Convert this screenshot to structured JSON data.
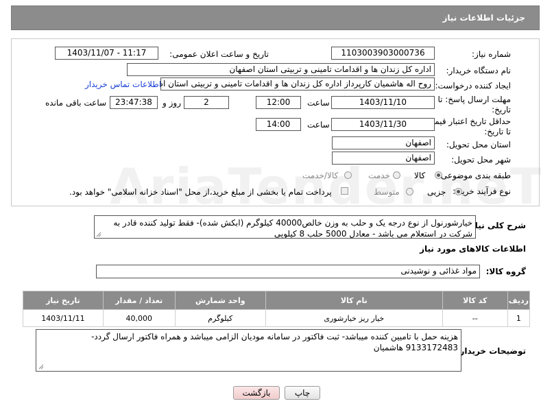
{
  "header": {
    "title": "جزئیات اطلاعات نیاز"
  },
  "fields": {
    "need_number_label": "شماره نیاز:",
    "need_number": "1103003903000736",
    "announce_label": "تاریخ و ساعت اعلان عمومی:",
    "announce_value": "1403/11/07 - 11:17",
    "buyer_org_label": "نام دستگاه خریدار:",
    "buyer_org": "اداره کل زندان ها و اقدامات تامینی و تربیتی استان اصفهان",
    "requester_label": "ایجاد کننده درخواست:",
    "requester": "روح اله هاشمیان کارپرداز اداره کل زندان ها و اقدامات تامینی و تربیتی استان اصفهان",
    "contact_link": "اطلاعات تماس خریدار",
    "deadline_label": "مهلت ارسال پاسخ: تا تاریخ:",
    "deadline_date": "1403/11/10",
    "time_label": "ساعت",
    "deadline_time": "12:00",
    "days_value": "2",
    "days_label": "روز و",
    "remaining_time": "23:47:38",
    "remaining_label": "ساعت باقی مانده",
    "validity_label": "حداقل تاریخ اعتبار قیمت: تا تاریخ:",
    "validity_date": "1403/11/30",
    "validity_time": "14:00",
    "province_label": "استان محل تحویل:",
    "province": "اصفهان",
    "city_label": "شهر محل تحویل:",
    "city": "اصفهان",
    "category_label": "طبقه بندی موضوعی:",
    "cat_goods": "کالا",
    "cat_service": "خدمت",
    "cat_goods_service": "کالا/خدمت",
    "process_label": "نوع فرآیند خرید :",
    "proc_partial": "جزیی",
    "proc_medium": "متوسط",
    "payment_note": "پرداخت تمام یا بخشی از مبلغ خرید،از محل \"اسناد خزانه اسلامی\" خواهد بود."
  },
  "description": {
    "label": "شرح کلی نیاز:",
    "text": "خیارشورنول از نوع درجه یک و حلب  به وزن خالص40000 کیلوگرم (ابکش شده)- فقط تولید کننده قادر به شرکت در استعلام می باشد - معادل 5000 حلب 8 کیلویی"
  },
  "goods_section": {
    "title": "اطلاعات کالاهای مورد نیاز",
    "group_label": "گروه کالا:",
    "group_value": "مواد غذائی و نوشیدنی"
  },
  "table": {
    "headers": [
      "ردیف",
      "کد کالا",
      "نام کالا",
      "واحد شمارش",
      "تعداد / مقدار",
      "تاریخ نیاز"
    ],
    "rows": [
      [
        "1",
        "--",
        "خیار ریز خیارشوری",
        "کیلوگرم",
        "40,000",
        "1403/11/11"
      ]
    ]
  },
  "buyer_notes": {
    "label": "توضیحات خریدار:",
    "text": "هزینه حمل با تامیین کننده میباشد- ثبت فاکتور در سامانه مودیان الزامی میباشد و همراه فاکتور ارسال گردد- 9133172483 هاشمیان"
  },
  "buttons": {
    "print": "چاپ",
    "back": "بازگشت"
  },
  "watermark": "AriaTender.neT",
  "colors": {
    "header_bg": "#8c8c8c",
    "link": "#1a3fd6",
    "back_btn_bg": "#f6d9d9"
  }
}
